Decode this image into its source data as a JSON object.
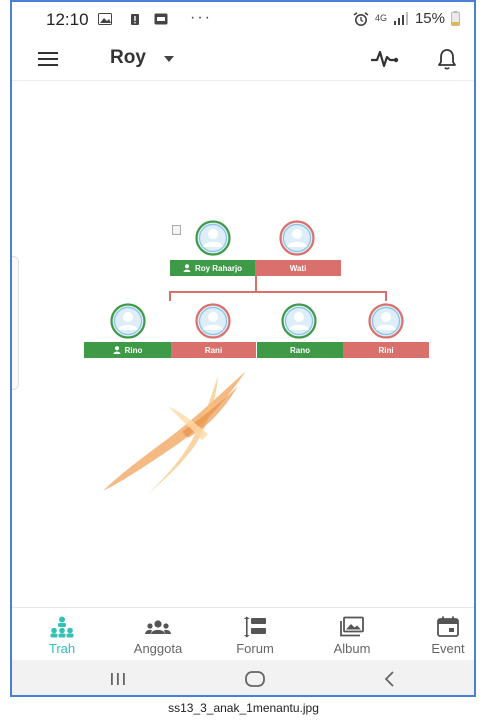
{
  "status_bar": {
    "time": "12:10",
    "dots": "···",
    "network": "4G",
    "battery": "15%"
  },
  "app_bar": {
    "title": "Roy"
  },
  "tree": {
    "parents": [
      {
        "name": "Roy Raharjo",
        "gender": "male"
      },
      {
        "name": "Wati",
        "gender": "female"
      }
    ],
    "children": [
      {
        "name": "Rino",
        "gender": "male"
      },
      {
        "name": "Rani",
        "gender": "female"
      },
      {
        "name": "Rano",
        "gender": "male"
      },
      {
        "name": "Rini",
        "gender": "female"
      }
    ]
  },
  "bottom_nav": {
    "items": [
      {
        "label": "Trah",
        "icon": "family-tree-icon",
        "active": true
      },
      {
        "label": "Anggota",
        "icon": "people-icon",
        "active": false
      },
      {
        "label": "Forum",
        "icon": "forum-icon",
        "active": false
      },
      {
        "label": "Album",
        "icon": "album-icon",
        "active": false
      },
      {
        "label": "Event",
        "icon": "event-icon",
        "active": false
      }
    ]
  },
  "caption": "ss13_3_anak_1menantu.jpg",
  "colors": {
    "male_tag": "#3f9a48",
    "female_tag": "#d9706c",
    "active_nav": "#31c1b7",
    "frame_border": "#4a7fd6"
  }
}
